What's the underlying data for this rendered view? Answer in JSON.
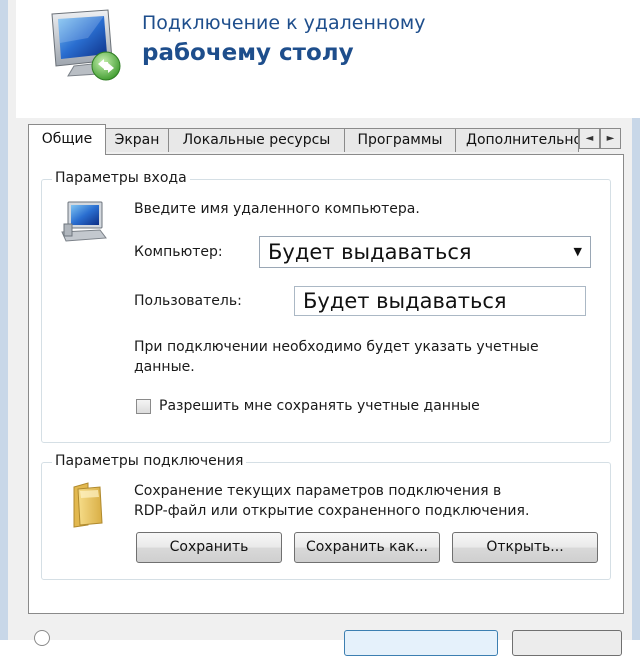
{
  "header": {
    "title_line1": "Подключение к удаленному",
    "title_line2": "рабочему столу"
  },
  "tabs": [
    {
      "label": "Общие",
      "active": true
    },
    {
      "label": "Экран",
      "active": false
    },
    {
      "label": "Локальные ресурсы",
      "active": false
    },
    {
      "label": "Программы",
      "active": false
    },
    {
      "label": "Дополнительно",
      "active": false
    }
  ],
  "tab_scroll": {
    "left": "◄",
    "right": "►"
  },
  "login": {
    "group_title": "Параметры входа",
    "prompt": "Введите имя удаленного компьютера.",
    "computer_label": "Компьютер:",
    "computer_value": "Будет выдаваться",
    "user_label": "Пользователь:",
    "user_value": "Будет выдаваться",
    "note_line1": "При подключении необходимо будет указать учетные",
    "note_line2": "данные.",
    "save_credentials_label": "Разрешить мне сохранять учетные данные",
    "save_credentials_checked": false
  },
  "connection": {
    "group_title": "Параметры подключения",
    "desc_line1": "Сохранение текущих параметров подключения в",
    "desc_line2": "RDP-файл или открытие сохраненного подключения.",
    "save_label": "Сохранить",
    "save_as_label": "Сохранить как...",
    "open_label": "Открыть..."
  },
  "colors": {
    "title_blue": "#1e4e8c",
    "frame_blue": "#c8d7e8"
  }
}
